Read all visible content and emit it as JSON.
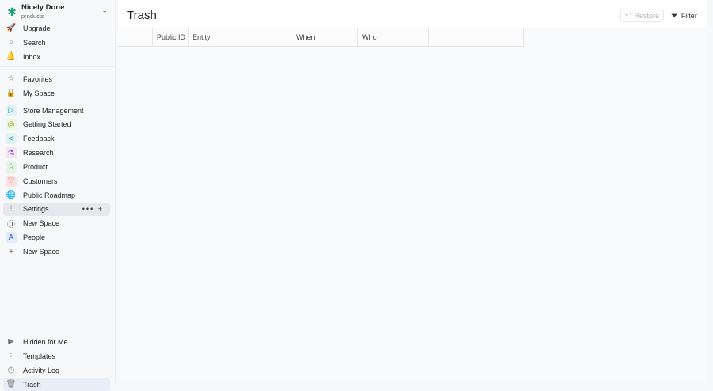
{
  "workspace": {
    "name": "Nicely Done",
    "subtitle": "products"
  },
  "nav_top": [
    {
      "label": "Upgrade",
      "icon": "rocket-icon"
    },
    {
      "label": "Search",
      "icon": "search-icon"
    },
    {
      "label": "Inbox",
      "icon": "bell-icon"
    }
  ],
  "nav_mid": [
    {
      "label": "Favorites",
      "icon": "star-icon"
    },
    {
      "label": "My Space",
      "icon": "lock-icon"
    }
  ],
  "spaces": [
    {
      "label": "Store Management",
      "icon": "play-icon",
      "color": "#1ba7c7",
      "bg": "#e3f4f8",
      "glyph": "▷"
    },
    {
      "label": "Getting Started",
      "icon": "play-circle-icon",
      "color": "#7aa629",
      "bg": "#eef5e0",
      "glyph": "◎"
    },
    {
      "label": "Feedback",
      "icon": "megaphone-icon",
      "color": "#2aa1a1",
      "bg": "#e1f3f3",
      "glyph": "⊲"
    },
    {
      "label": "Research",
      "icon": "flask-icon",
      "color": "#a254c9",
      "bg": "#f1e5f8",
      "glyph": "⚗"
    },
    {
      "label": "Product",
      "icon": "star-icon",
      "color": "#47a447",
      "bg": "#e5f4e5",
      "glyph": "☆"
    },
    {
      "label": "Customers",
      "icon": "heart-icon",
      "color": "#d9413b",
      "bg": "#fbe3e2",
      "glyph": "♡"
    },
    {
      "label": "Public Roadmap",
      "icon": "globe-icon",
      "color": "#1f9bb0",
      "bg": "#f7f8fa",
      "glyph": "🌐"
    },
    {
      "label": "Settings",
      "icon": "sliders-icon",
      "color": "#6b7280",
      "bg": "#e6e8ec",
      "glyph": "⫶"
    },
    {
      "label": "New Space",
      "icon": "zero-badge-icon",
      "color": "#555",
      "bg": "#f7f8fa",
      "glyph": "⓪"
    },
    {
      "label": "People",
      "icon": "contact-icon",
      "color": "#3569d1",
      "bg": "#e3ebfa",
      "glyph": "A"
    },
    {
      "label": "New Space",
      "icon": "plus-icon",
      "color": "#666",
      "bg": "transparent",
      "glyph": "+"
    }
  ],
  "settings_actions": {
    "more": "•••",
    "add": "+"
  },
  "nav_bottom": [
    {
      "label": "Hidden for Me",
      "icon": "caret-right-icon"
    },
    {
      "label": "Templates",
      "icon": "templates-icon"
    },
    {
      "label": "Activity Log",
      "icon": "clock-icon"
    },
    {
      "label": "Trash",
      "icon": "trash-icon"
    }
  ],
  "page": {
    "title": "Trash",
    "restore_label": "Restore",
    "filter_label": "Filter"
  },
  "table": {
    "columns": [
      "",
      "Public ID",
      "Entity",
      "When",
      "Who",
      ""
    ]
  }
}
